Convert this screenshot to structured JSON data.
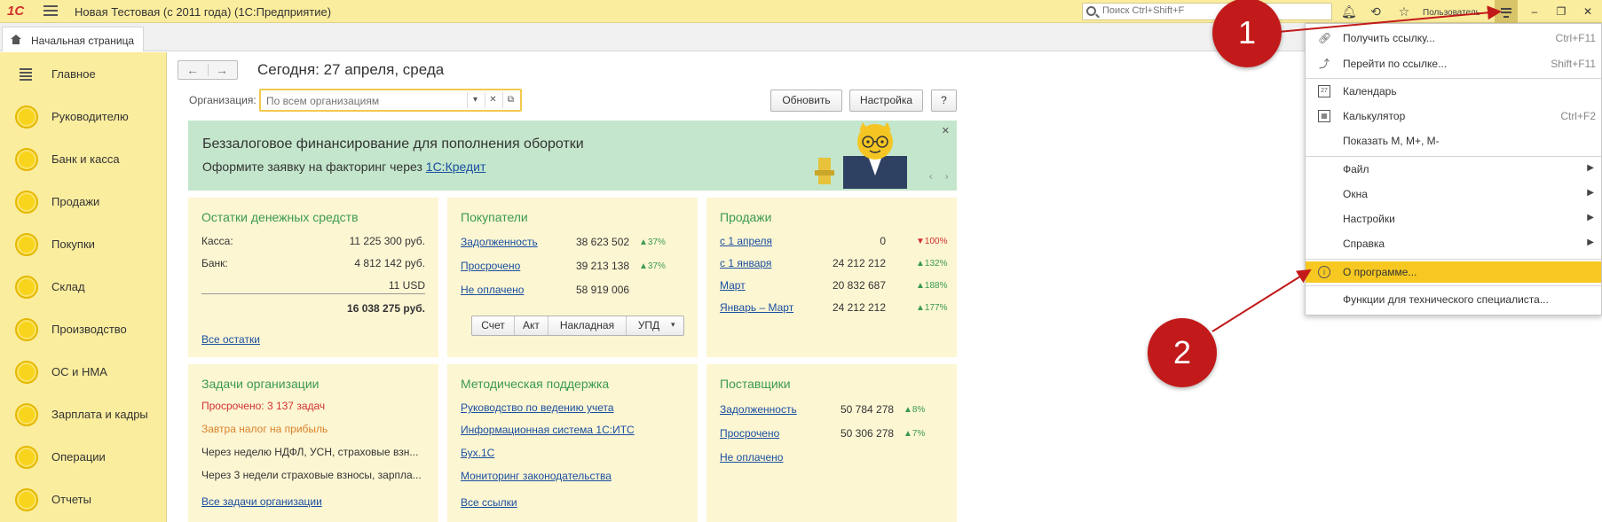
{
  "titlebar": {
    "logo": "1С",
    "app_title": "Новая Тестовая (с 2011 года)  (1С:Предприятие)",
    "search_placeholder": "Поиск Ctrl+Shift+F",
    "user_label": "Пользователь"
  },
  "tabs": [
    {
      "label": "Начальная страница"
    }
  ],
  "sidebar": {
    "items": [
      {
        "label": "Главное",
        "icon": "menu-icon"
      },
      {
        "label": "Руководителю",
        "icon": "circle-icon"
      },
      {
        "label": "Банк и касса",
        "icon": "circle-icon"
      },
      {
        "label": "Продажи",
        "icon": "circle-icon"
      },
      {
        "label": "Покупки",
        "icon": "circle-icon"
      },
      {
        "label": "Склад",
        "icon": "circle-icon"
      },
      {
        "label": "Производство",
        "icon": "circle-icon"
      },
      {
        "label": "ОС и НМА",
        "icon": "circle-icon"
      },
      {
        "label": "Зарплата и кадры",
        "icon": "circle-icon"
      },
      {
        "label": "Операции",
        "icon": "circle-icon"
      },
      {
        "label": "Отчеты",
        "icon": "circle-icon"
      }
    ]
  },
  "main": {
    "title": "Сегодня: 27 апреля, среда",
    "org_label": "Организация:",
    "org_placeholder": "По всем организациям",
    "buttons": {
      "refresh": "Обновить",
      "settings": "Настройка",
      "help": "?"
    },
    "banner": {
      "heading": "Беззалоговое финансирование для пополнения оборотки",
      "text": "Оформите заявку на факторинг через ",
      "link": "1С:Кредит"
    },
    "cash": {
      "title": "Остатки денежных средств",
      "rows": [
        {
          "label": "Касса:",
          "value": "11 225 300 руб."
        },
        {
          "label": "Банк:",
          "value": "4 812 142 руб."
        },
        {
          "label": "",
          "value": "11 USD"
        }
      ],
      "total": "16 038 275 руб.",
      "link": "Все остатки"
    },
    "buyers": {
      "title": "Покупатели",
      "rows": [
        {
          "label": "Задолженность",
          "value": "38 623 502",
          "delta": "▲37%"
        },
        {
          "label": "Просрочено",
          "value": "39 213 138",
          "delta": "▲37%"
        },
        {
          "label": "Не оплачено",
          "value": "58 919 006",
          "delta": ""
        }
      ],
      "docs": [
        "Счет",
        "Акт",
        "Накладная",
        "УПД"
      ]
    },
    "sales": {
      "title": "Продажи",
      "rows": [
        {
          "label": "с 1 апреля",
          "value": "0",
          "delta": "▼100%",
          "dir": "down"
        },
        {
          "label": "с 1 января",
          "value": "24 212 212",
          "delta": "▲132%",
          "dir": "up"
        },
        {
          "label": "Март",
          "value": "20 832 687",
          "delta": "▲188%",
          "dir": "up"
        },
        {
          "label": "Январь – Март",
          "value": "24 212 212",
          "delta": "▲177%",
          "dir": "up"
        }
      ]
    },
    "tasks": {
      "title": "Задачи организации",
      "overdue": "Просрочено: 3 137 задач",
      "tomorrow": "Завтра налог на прибыль",
      "week": "Через неделю НДФЛ, УСН, страховые взн...",
      "weeks3": "Через 3 недели страховые взносы, зарпла...",
      "link": "Все задачи организации"
    },
    "support": {
      "title": "Методическая поддержка",
      "links": [
        "Руководство по ведению учета",
        "Информационная система 1С:ИТС",
        "Бух.1С",
        "Мониторинг законодательства"
      ],
      "all": "Все ссылки"
    },
    "suppliers": {
      "title": "Поставщики",
      "rows": [
        {
          "label": "Задолженность",
          "value": "50 784 278",
          "delta": "▲8%"
        },
        {
          "label": "Просрочено",
          "value": "50 306 278",
          "delta": "▲7%"
        },
        {
          "label": "Не оплачено",
          "value": "",
          "delta": ""
        }
      ]
    }
  },
  "menu": {
    "items": [
      {
        "label": "Получить ссылку...",
        "shortcut": "Ctrl+F11",
        "icon": "link-icon"
      },
      {
        "label": "Перейти по ссылке...",
        "shortcut": "Shift+F11",
        "icon": "goto-link-icon"
      },
      {
        "label": "Календарь",
        "shortcut": "",
        "icon": "calendar-icon"
      },
      {
        "label": "Калькулятор",
        "shortcut": "Ctrl+F2",
        "icon": "calculator-icon"
      },
      {
        "label": "Показать М, М+, М-",
        "shortcut": "",
        "icon": ""
      },
      {
        "label": "Файл",
        "submenu": true
      },
      {
        "label": "Окна",
        "submenu": true
      },
      {
        "label": "Настройки",
        "submenu": true
      },
      {
        "label": "Справка",
        "submenu": true
      },
      {
        "label": "О программе...",
        "icon": "info-icon",
        "highlighted": true
      },
      {
        "label": "Функции для технического специалиста...",
        "icon": ""
      }
    ]
  },
  "annotations": {
    "badge1": "1",
    "badge2": "2"
  },
  "colors": {
    "header_yellow": "#fbed9e",
    "green_title": "#3a9a4f",
    "link_blue": "#1a4fa0",
    "highlight": "#f7c821",
    "annotation_red": "#c21a1a"
  }
}
